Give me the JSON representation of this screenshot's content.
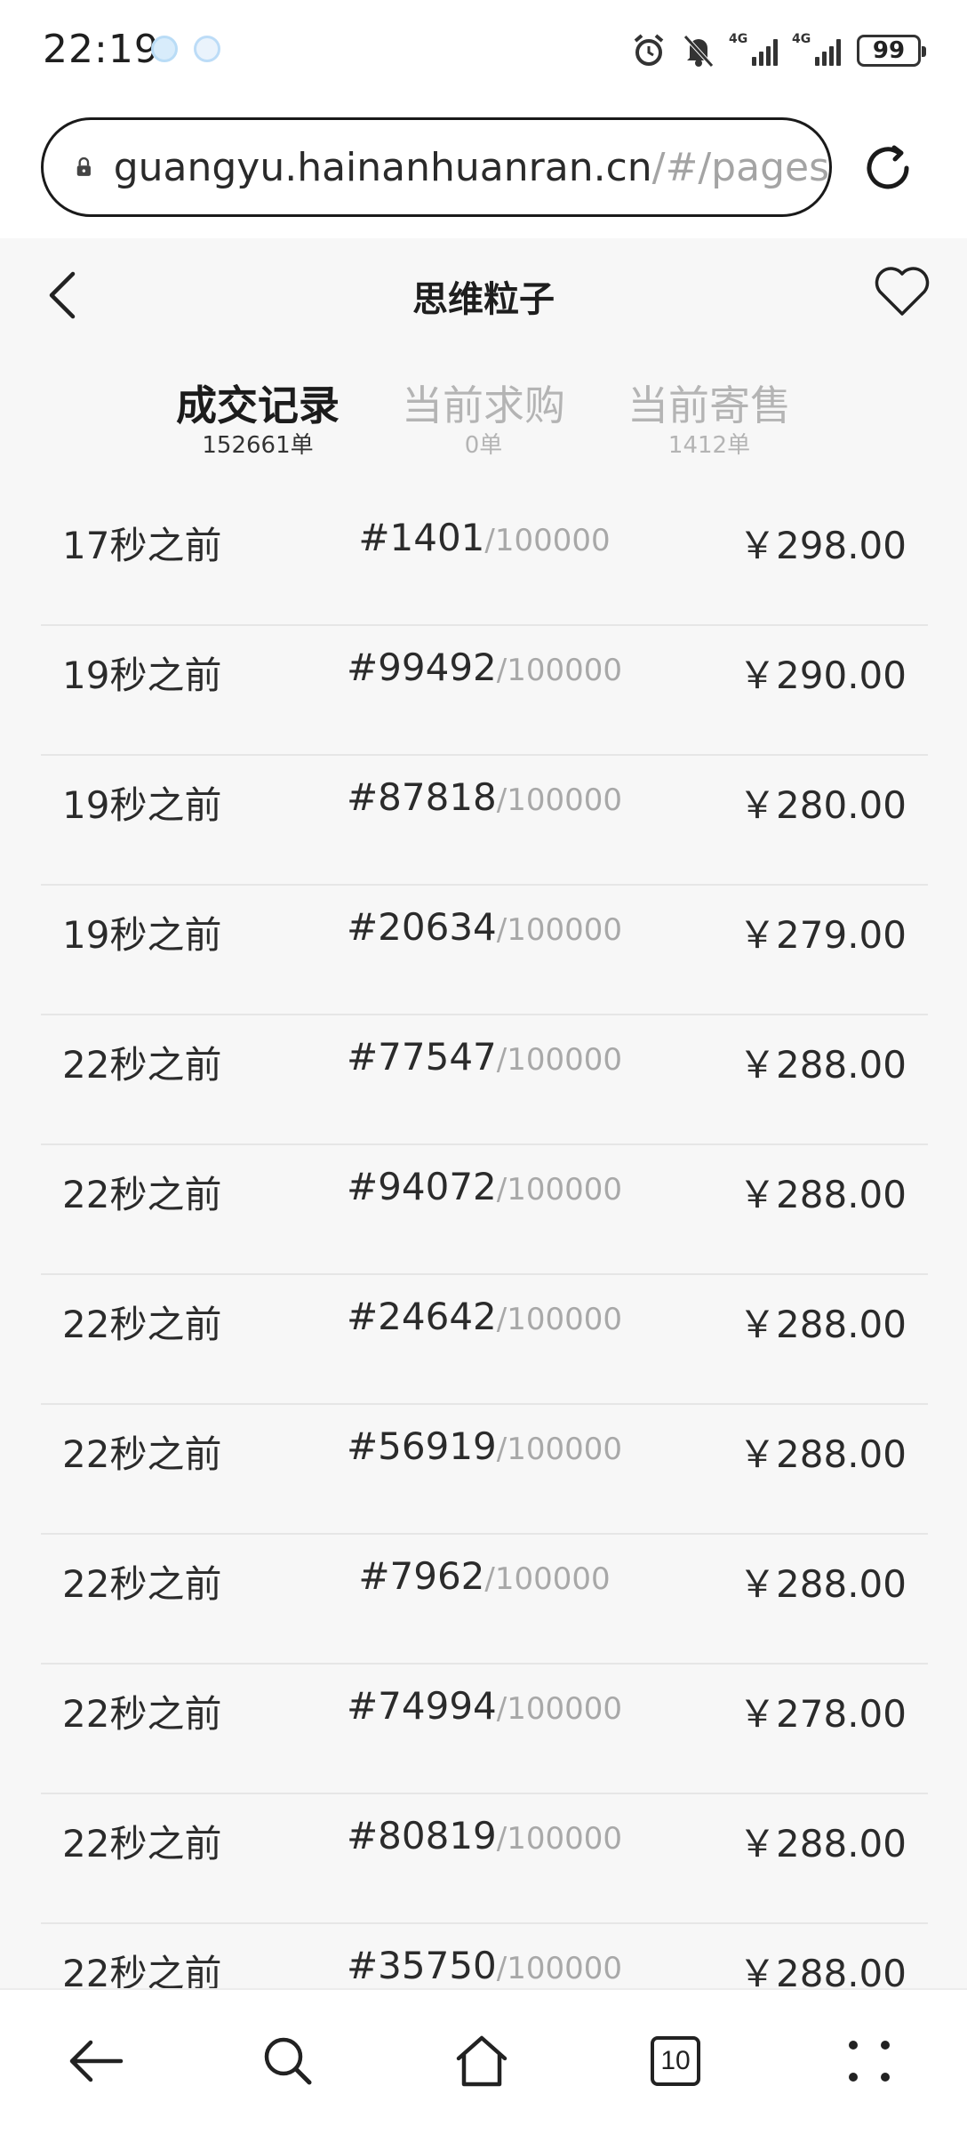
{
  "status_bar": {
    "time": "22:19",
    "battery": "99",
    "signal_1": "4G",
    "signal_2": "4G"
  },
  "browser": {
    "url_main": "guangyu.hainanhuanran.cn",
    "url_path": "/#/pages",
    "tab_count": "10"
  },
  "header": {
    "title": "思维粒子"
  },
  "tabs": [
    {
      "label": "成交记录",
      "count": "152661单"
    },
    {
      "label": "当前求购",
      "count": "0单"
    },
    {
      "label": "当前寄售",
      "count": "1412单"
    }
  ],
  "records": [
    {
      "time": "17秒之前",
      "number": "#1401",
      "total": "/100000",
      "price": "￥298.00"
    },
    {
      "time": "19秒之前",
      "number": "#99492",
      "total": "/100000",
      "price": "￥290.00"
    },
    {
      "time": "19秒之前",
      "number": "#87818",
      "total": "/100000",
      "price": "￥280.00"
    },
    {
      "time": "19秒之前",
      "number": "#20634",
      "total": "/100000",
      "price": "￥279.00"
    },
    {
      "time": "22秒之前",
      "number": "#77547",
      "total": "/100000",
      "price": "￥288.00"
    },
    {
      "time": "22秒之前",
      "number": "#94072",
      "total": "/100000",
      "price": "￥288.00"
    },
    {
      "time": "22秒之前",
      "number": "#24642",
      "total": "/100000",
      "price": "￥288.00"
    },
    {
      "time": "22秒之前",
      "number": "#56919",
      "total": "/100000",
      "price": "￥288.00"
    },
    {
      "time": "22秒之前",
      "number": "#7962",
      "total": "/100000",
      "price": "￥288.00"
    },
    {
      "time": "22秒之前",
      "number": "#74994",
      "total": "/100000",
      "price": "￥278.00"
    },
    {
      "time": "22秒之前",
      "number": "#80819",
      "total": "/100000",
      "price": "￥288.00"
    },
    {
      "time": "22秒之前",
      "number": "#35750",
      "total": "/100000",
      "price": "￥288.00"
    }
  ],
  "colors": {
    "page_bg": "#f7f7f7",
    "active_tab": "#1c1c1c",
    "inactive_tab": "#b4b4b4",
    "divider": "#e6e6e6"
  }
}
